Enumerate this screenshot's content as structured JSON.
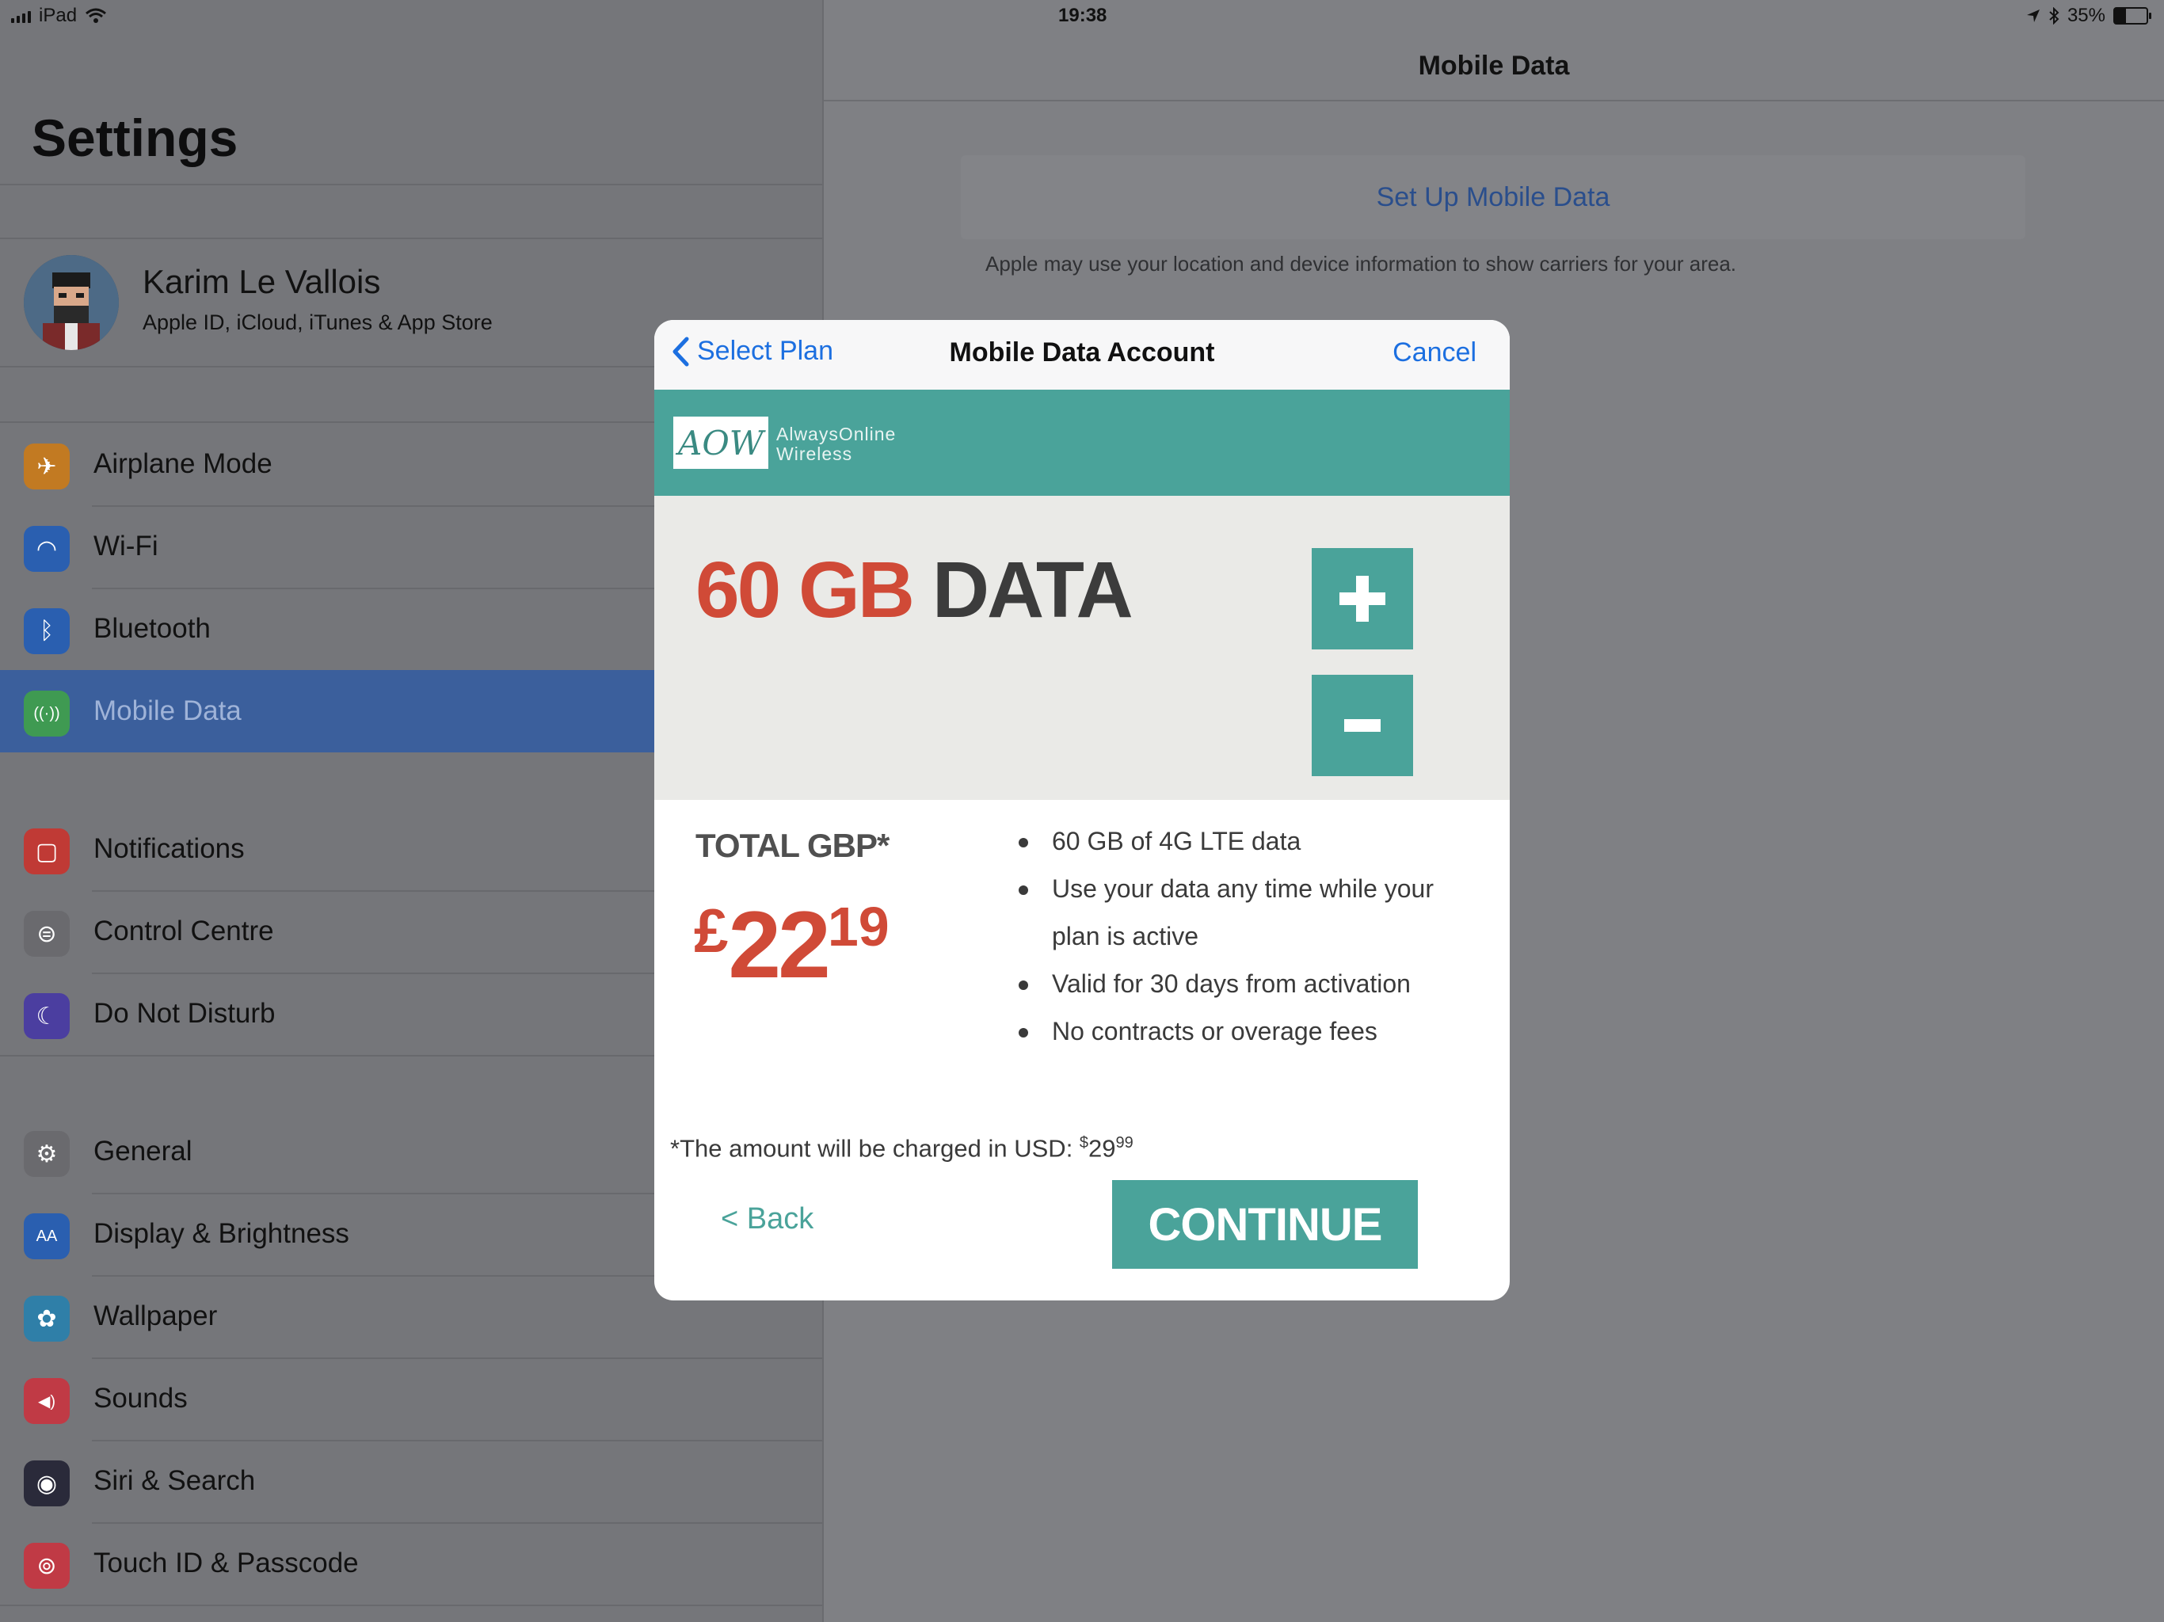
{
  "status_bar": {
    "device": "iPad",
    "time": "19:38",
    "battery": "35%",
    "battery_level": 0.35
  },
  "sidebar": {
    "title": "Settings",
    "profile": {
      "name": "Karim Le Vallois",
      "subtitle": "Apple ID, iCloud, iTunes & App Store"
    },
    "groups": [
      [
        {
          "label": "Airplane Mode",
          "icon": "airplane-icon",
          "color": "#c27a22"
        },
        {
          "label": "Wi-Fi",
          "icon": "wifi-icon",
          "color": "#2a5fb0"
        },
        {
          "label": "Bluetooth",
          "icon": "bluetooth-icon",
          "color": "#2a5fb0"
        },
        {
          "label": "Mobile Data",
          "icon": "antenna-icon",
          "color": "#3f9a52",
          "selected": true
        }
      ],
      [
        {
          "label": "Notifications",
          "icon": "notifications-icon",
          "color": "#c03a35"
        },
        {
          "label": "Control Centre",
          "icon": "control-centre-icon",
          "color": "#6a6a6e"
        },
        {
          "label": "Do Not Disturb",
          "icon": "moon-icon",
          "color": "#4b3ea0"
        }
      ],
      [
        {
          "label": "General",
          "icon": "gear-icon",
          "color": "#6a6a6e"
        },
        {
          "label": "Display & Brightness",
          "icon": "display-icon",
          "color": "#2a5fb0"
        },
        {
          "label": "Wallpaper",
          "icon": "wallpaper-icon",
          "color": "#2f7fa8"
        },
        {
          "label": "Sounds",
          "icon": "speaker-icon",
          "color": "#c03a45"
        },
        {
          "label": "Siri & Search",
          "icon": "siri-icon",
          "color": "#2a2a3a"
        },
        {
          "label": "Touch ID & Passcode",
          "icon": "fingerprint-icon",
          "color": "#c03a45"
        }
      ]
    ]
  },
  "detail": {
    "title": "Mobile Data",
    "setup_button": "Set Up Mobile Data",
    "note": "Apple may use your location and device information to show carriers for your area."
  },
  "modal": {
    "back_label": "Select Plan",
    "title": "Mobile Data Account",
    "cancel_label": "Cancel",
    "brand": {
      "logo_text": "AOW",
      "name_line1": "AlwaysOnline",
      "name_line2": "Wireless"
    },
    "plan": {
      "amount": "60 GB",
      "unit": "DATA"
    },
    "total_label": "TOTAL GBP*",
    "price": {
      "currency": "£",
      "whole": "22",
      "cents": "19"
    },
    "features": [
      "60 GB of 4G LTE data",
      "Use your data any time while your plan is active",
      "Valid for 30 days from activation",
      "No contracts or overage fees"
    ],
    "usd_note": {
      "text": "*The amount will be charged in USD: ",
      "currency": "$",
      "whole": "29",
      "cents": "99"
    },
    "back_link": "< Back",
    "continue": "CONTINUE"
  }
}
